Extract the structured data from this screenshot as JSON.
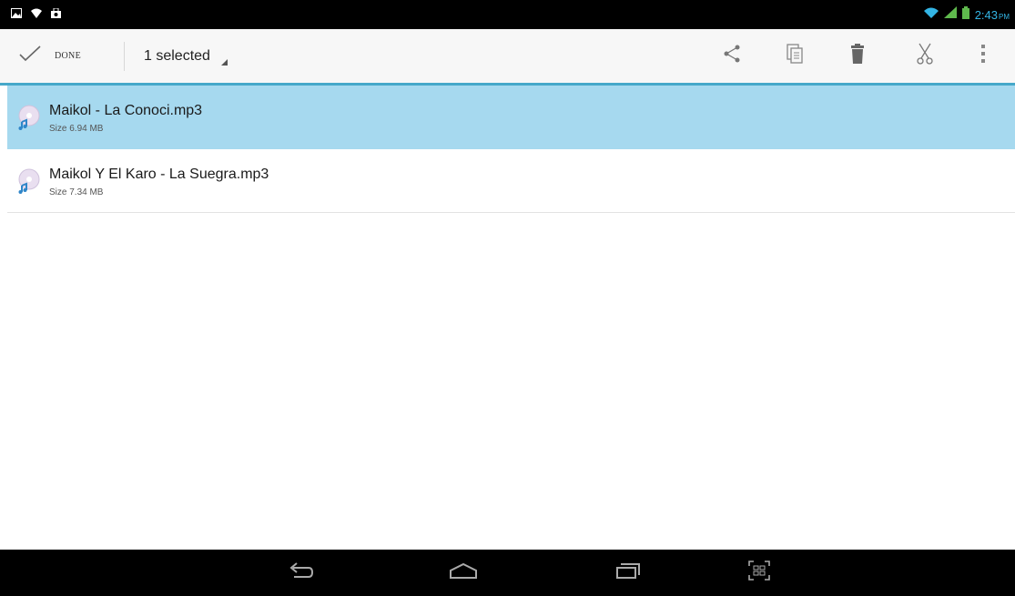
{
  "status_bar": {
    "icons_left": [
      "picture-icon",
      "wifi-question-icon",
      "bag-icon"
    ],
    "icons_right": [
      "wifi-icon",
      "signal-icon",
      "battery-icon"
    ],
    "time": "2:43",
    "ampm": "PM",
    "accent_color": "#33b5e5"
  },
  "action_bar": {
    "done_label": "DONE",
    "selection_label": "1 selected",
    "actions": [
      "share-icon",
      "copy-icon",
      "delete-icon",
      "cut-icon",
      "overflow-menu-icon"
    ],
    "accent_color": "#46a8c9"
  },
  "files": [
    {
      "name": "Maikol - La Conoci.mp3",
      "size": "Size 6.94 MB",
      "selected": true
    },
    {
      "name": "Maikol Y El Karo - La Suegra.mp3",
      "size": "Size 7.34 MB",
      "selected": false
    }
  ],
  "selection_color": "#a6d9ef",
  "nav_bar": {
    "buttons": [
      "back-icon",
      "home-icon",
      "recent-apps-icon",
      "screenshot-icon"
    ]
  }
}
